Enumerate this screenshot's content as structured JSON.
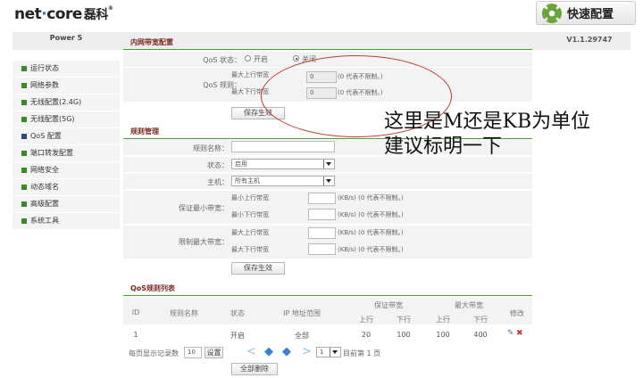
{
  "header": {
    "logo_text": "net·core",
    "logo_part1": "net",
    "logo_dot": "·",
    "logo_part2": "core",
    "logo_cn": "磊科",
    "logo_reg": "®",
    "quick_setup": "快速配置",
    "model": "Power 5",
    "version": "V1.1.29747"
  },
  "sidebar": {
    "items": [
      {
        "label": "运行状态"
      },
      {
        "label": "网络参数"
      },
      {
        "label": "无线配置(2.4G)"
      },
      {
        "label": "无线配置(5G)"
      },
      {
        "label": "QoS 配置"
      },
      {
        "label": "端口转发配置"
      },
      {
        "label": "网络安全"
      },
      {
        "label": "动态域名"
      },
      {
        "label": "高级配置"
      },
      {
        "label": "系统工具"
      }
    ]
  },
  "bandwidth": {
    "title": "内网带宽配置",
    "qos_state_label": "QoS 状态：",
    "opt_on": "开启",
    "opt_off": "关闭",
    "qos_rule_label": "QoS 规则：",
    "max_up_label": "最大上行带宽",
    "max_down_label": "最大下行带宽",
    "max_up_value": "0",
    "max_down_value": "0",
    "hint": "(0 代表不限制。)",
    "save": "保存生效"
  },
  "rules": {
    "title": "规则管理",
    "name_label": "规则名称：",
    "state_label": "状态：",
    "state_value": "启用",
    "host_label": "主机：",
    "host_value": "所有主机",
    "min_bw_label": "保证最小带宽：",
    "max_bw_label": "限制最大带宽：",
    "min_up": "最小上行带宽",
    "min_down": "最小下行带宽",
    "max_up": "最大上行带宽",
    "max_down": "最大下行带宽",
    "kb_hint": "(KB/s) (0 代表不限制。)",
    "save": "保存生效"
  },
  "rule_list": {
    "title": "QoS规则列表",
    "headers": {
      "id": "ID",
      "name": "规则名称",
      "state": "状态",
      "ip": "IP 地址范围",
      "guarantee": "保证带宽",
      "limit": "最大带宽",
      "up": "上行",
      "down": "下行",
      "edit": "修改"
    },
    "rows": [
      {
        "id": "1",
        "name": "",
        "state": "开启",
        "ip": "全部",
        "g_up": "20",
        "g_down": "100",
        "l_up": "100",
        "l_down": "400"
      }
    ],
    "per_page_label": "每页显示记录数",
    "per_page_value": "10",
    "set_button": "设置",
    "page_select": "1",
    "current_page": "目前第 1 页",
    "delete_all": "全部删除"
  },
  "annotation": {
    "line1": "这里是M还是KB为单位",
    "line2": "建议标明一下"
  },
  "colors": {
    "accent_green": "#4d9a3a",
    "title_brown": "#7a2a20",
    "annotation_red": "#c0392b",
    "pager_blue": "#3a7ed1"
  }
}
